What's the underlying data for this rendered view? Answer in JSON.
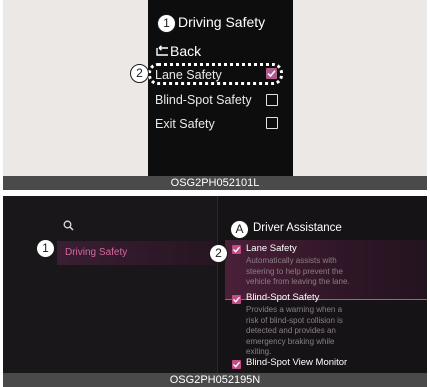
{
  "panel1": {
    "title": "Driving Safety",
    "back_label": "Back",
    "items": [
      {
        "label": "Lane Safety",
        "checked": true
      },
      {
        "label": "Blind-Spot Safety",
        "checked": false
      },
      {
        "label": "Exit Safety",
        "checked": false
      }
    ],
    "callouts": [
      "1",
      "2"
    ],
    "caption": "OSG2PH052101L"
  },
  "panel2": {
    "sidebar": {
      "item_label": "Driving Safety"
    },
    "header_title": "Driver Assistance",
    "callouts": [
      "A",
      "1",
      "2"
    ],
    "options": [
      {
        "label": "Lane Safety",
        "checked": true,
        "description": [
          "Automatically assists with",
          "steering to help prevent the",
          "vehicle from leaving the lane."
        ]
      },
      {
        "label": "Blind-Spot Safety",
        "checked": true,
        "description": [
          "Provides a warning when a",
          "risk of blind-spot collision is",
          "detected and provides an",
          "emergency braking while",
          "exiting."
        ]
      },
      {
        "label": "Blind-Spot View Monitor",
        "checked": true
      }
    ],
    "caption": "OSG2PH052195N"
  },
  "colors": {
    "accent": "#c24a86",
    "screen_bg": "#0e0d0d",
    "caption_bg": "#4a4a4a"
  }
}
